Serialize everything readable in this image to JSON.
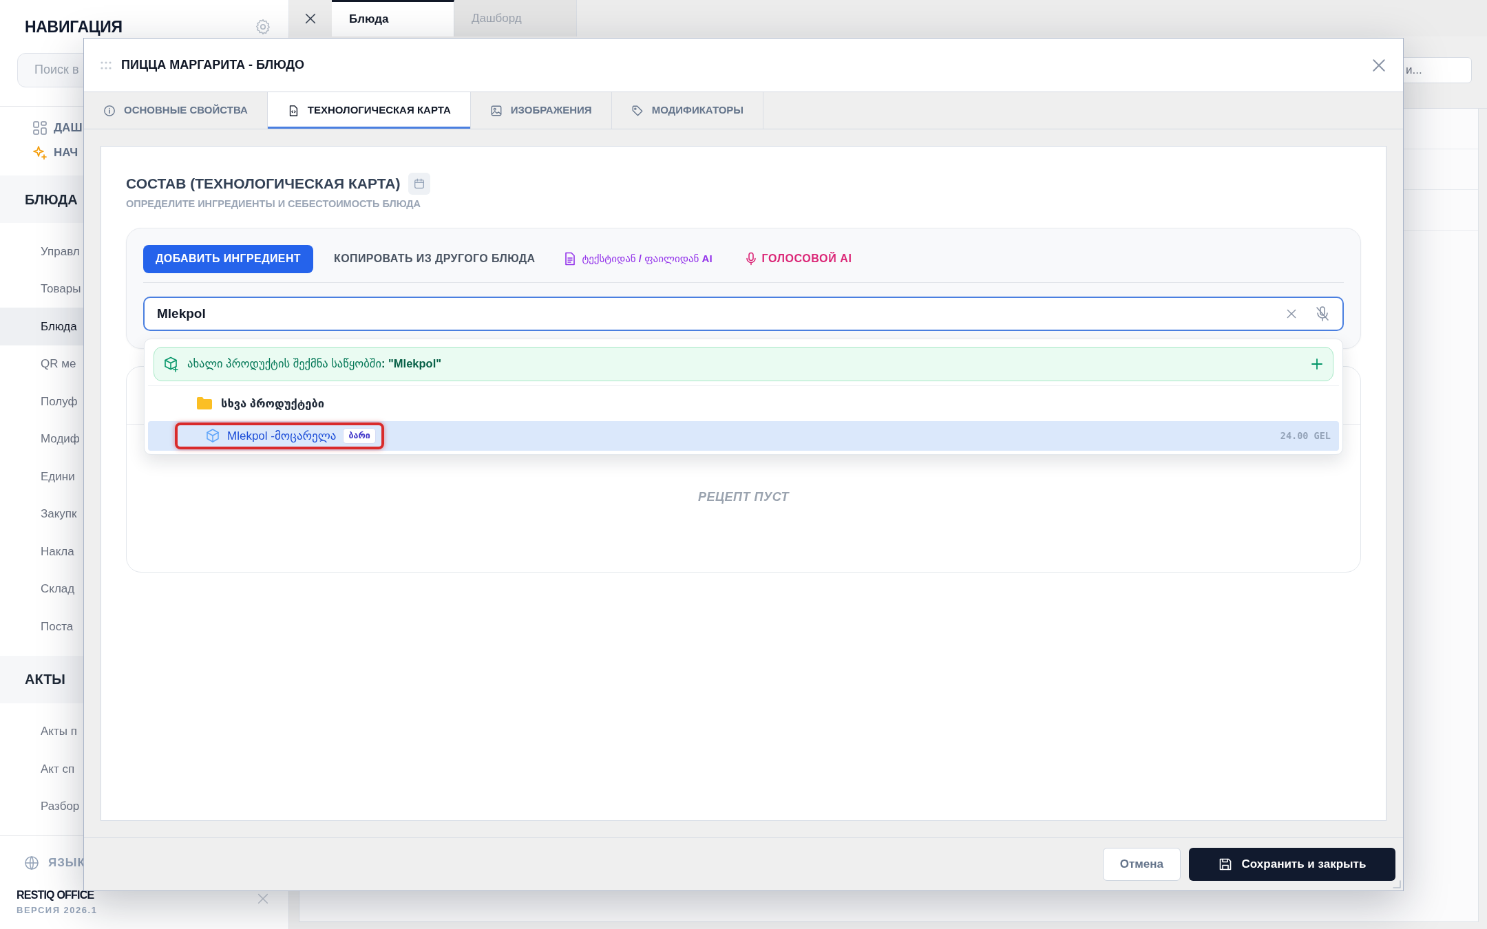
{
  "sidebar": {
    "title": "НАВИГАЦИЯ",
    "search": {
      "placeholder": "Поиск в"
    },
    "quick_links": [
      {
        "label": "ДАШ",
        "kind": "dashboard"
      },
      {
        "label": "НАЧ",
        "kind": "start"
      }
    ],
    "sections": [
      {
        "title": "БЛЮДА",
        "items": [
          {
            "label": "Управл",
            "selected": false
          },
          {
            "label": "Товары",
            "selected": false
          },
          {
            "label": "Блюда",
            "selected": true
          },
          {
            "label": "QR ме",
            "selected": false
          },
          {
            "label": "Полуф",
            "selected": false
          },
          {
            "label": "Модиф",
            "selected": false
          },
          {
            "label": "Едини",
            "selected": false
          },
          {
            "label": "Закупк",
            "selected": false
          },
          {
            "label": "Накла",
            "selected": false
          },
          {
            "label": "Склад",
            "selected": false
          },
          {
            "label": "Поста",
            "selected": false
          }
        ]
      },
      {
        "title": "АКТЫ",
        "items": [
          {
            "label": "Акты п",
            "selected": false
          },
          {
            "label": "Акт сп",
            "selected": false
          },
          {
            "label": "Разбор",
            "selected": false
          }
        ]
      }
    ],
    "language": "ЯЗЫК",
    "brand": "RESTIQ OFFICE",
    "version": "ВЕРСИЯ 2026.1"
  },
  "app_tabs": [
    {
      "label": "Блюда",
      "selected": true
    },
    {
      "label": "Дашборд",
      "selected": false
    }
  ],
  "main": {
    "search": {
      "placeholder": "и..."
    }
  },
  "modal": {
    "title": "ПИЦЦА МАРГАРИТА - БЛЮДО",
    "tabs": [
      {
        "label": "ОСНОВНЫЕ СВОЙСТВА",
        "selected": false
      },
      {
        "label": "ТЕХНОЛОГИЧЕСКАЯ КАРТА",
        "selected": true
      },
      {
        "label": "ИЗОБРАЖЕНИЯ",
        "selected": false
      },
      {
        "label": "МОДИФИКАТОРЫ",
        "selected": false
      }
    ],
    "section_title": "СОСТАВ (ТЕХНОЛОГИЧЕСКАЯ КАРТА)",
    "section_subtitle": "ОПРЕДЕЛИТЕ ИНГРЕДИЕНТЫ И СЕБЕСТОИМОСТЬ БЛЮДА",
    "actions": [
      {
        "kind": "primary",
        "label": "ДОБАВИТЬ ИНГРЕДИЕНТ"
      },
      {
        "kind": "plain",
        "label": "КОПИРОВАТЬ ИЗ ДРУГОГО БЛЮДА"
      },
      {
        "kind": "ai_text",
        "label": "ტექსტიდან **/** ფაილიდან **AI**"
      },
      {
        "kind": "voice",
        "label": "ГОЛОСОВОЙ AI"
      }
    ],
    "search": {
      "value": "Mlekpol"
    },
    "dropdown": {
      "create": "ახალი პროდუქტის შექმნა საწყობში**: \"Mlekpol\"**",
      "groups": [
        {
          "label": "სხვა პროდუქტები",
          "items": [
            {
              "name": "Mlekpol -მოცარელა",
              "tag": "ბარი",
              "price": "24.00 GEL",
              "selected": true,
              "highlighted": true
            }
          ]
        }
      ]
    },
    "empty_text": "РЕЦЕПТ ПУСТ",
    "buttons": [
      {
        "kind": "secondary",
        "label": "Отмена"
      },
      {
        "kind": "primary",
        "label": "Сохранить и закрыть"
      }
    ]
  }
}
